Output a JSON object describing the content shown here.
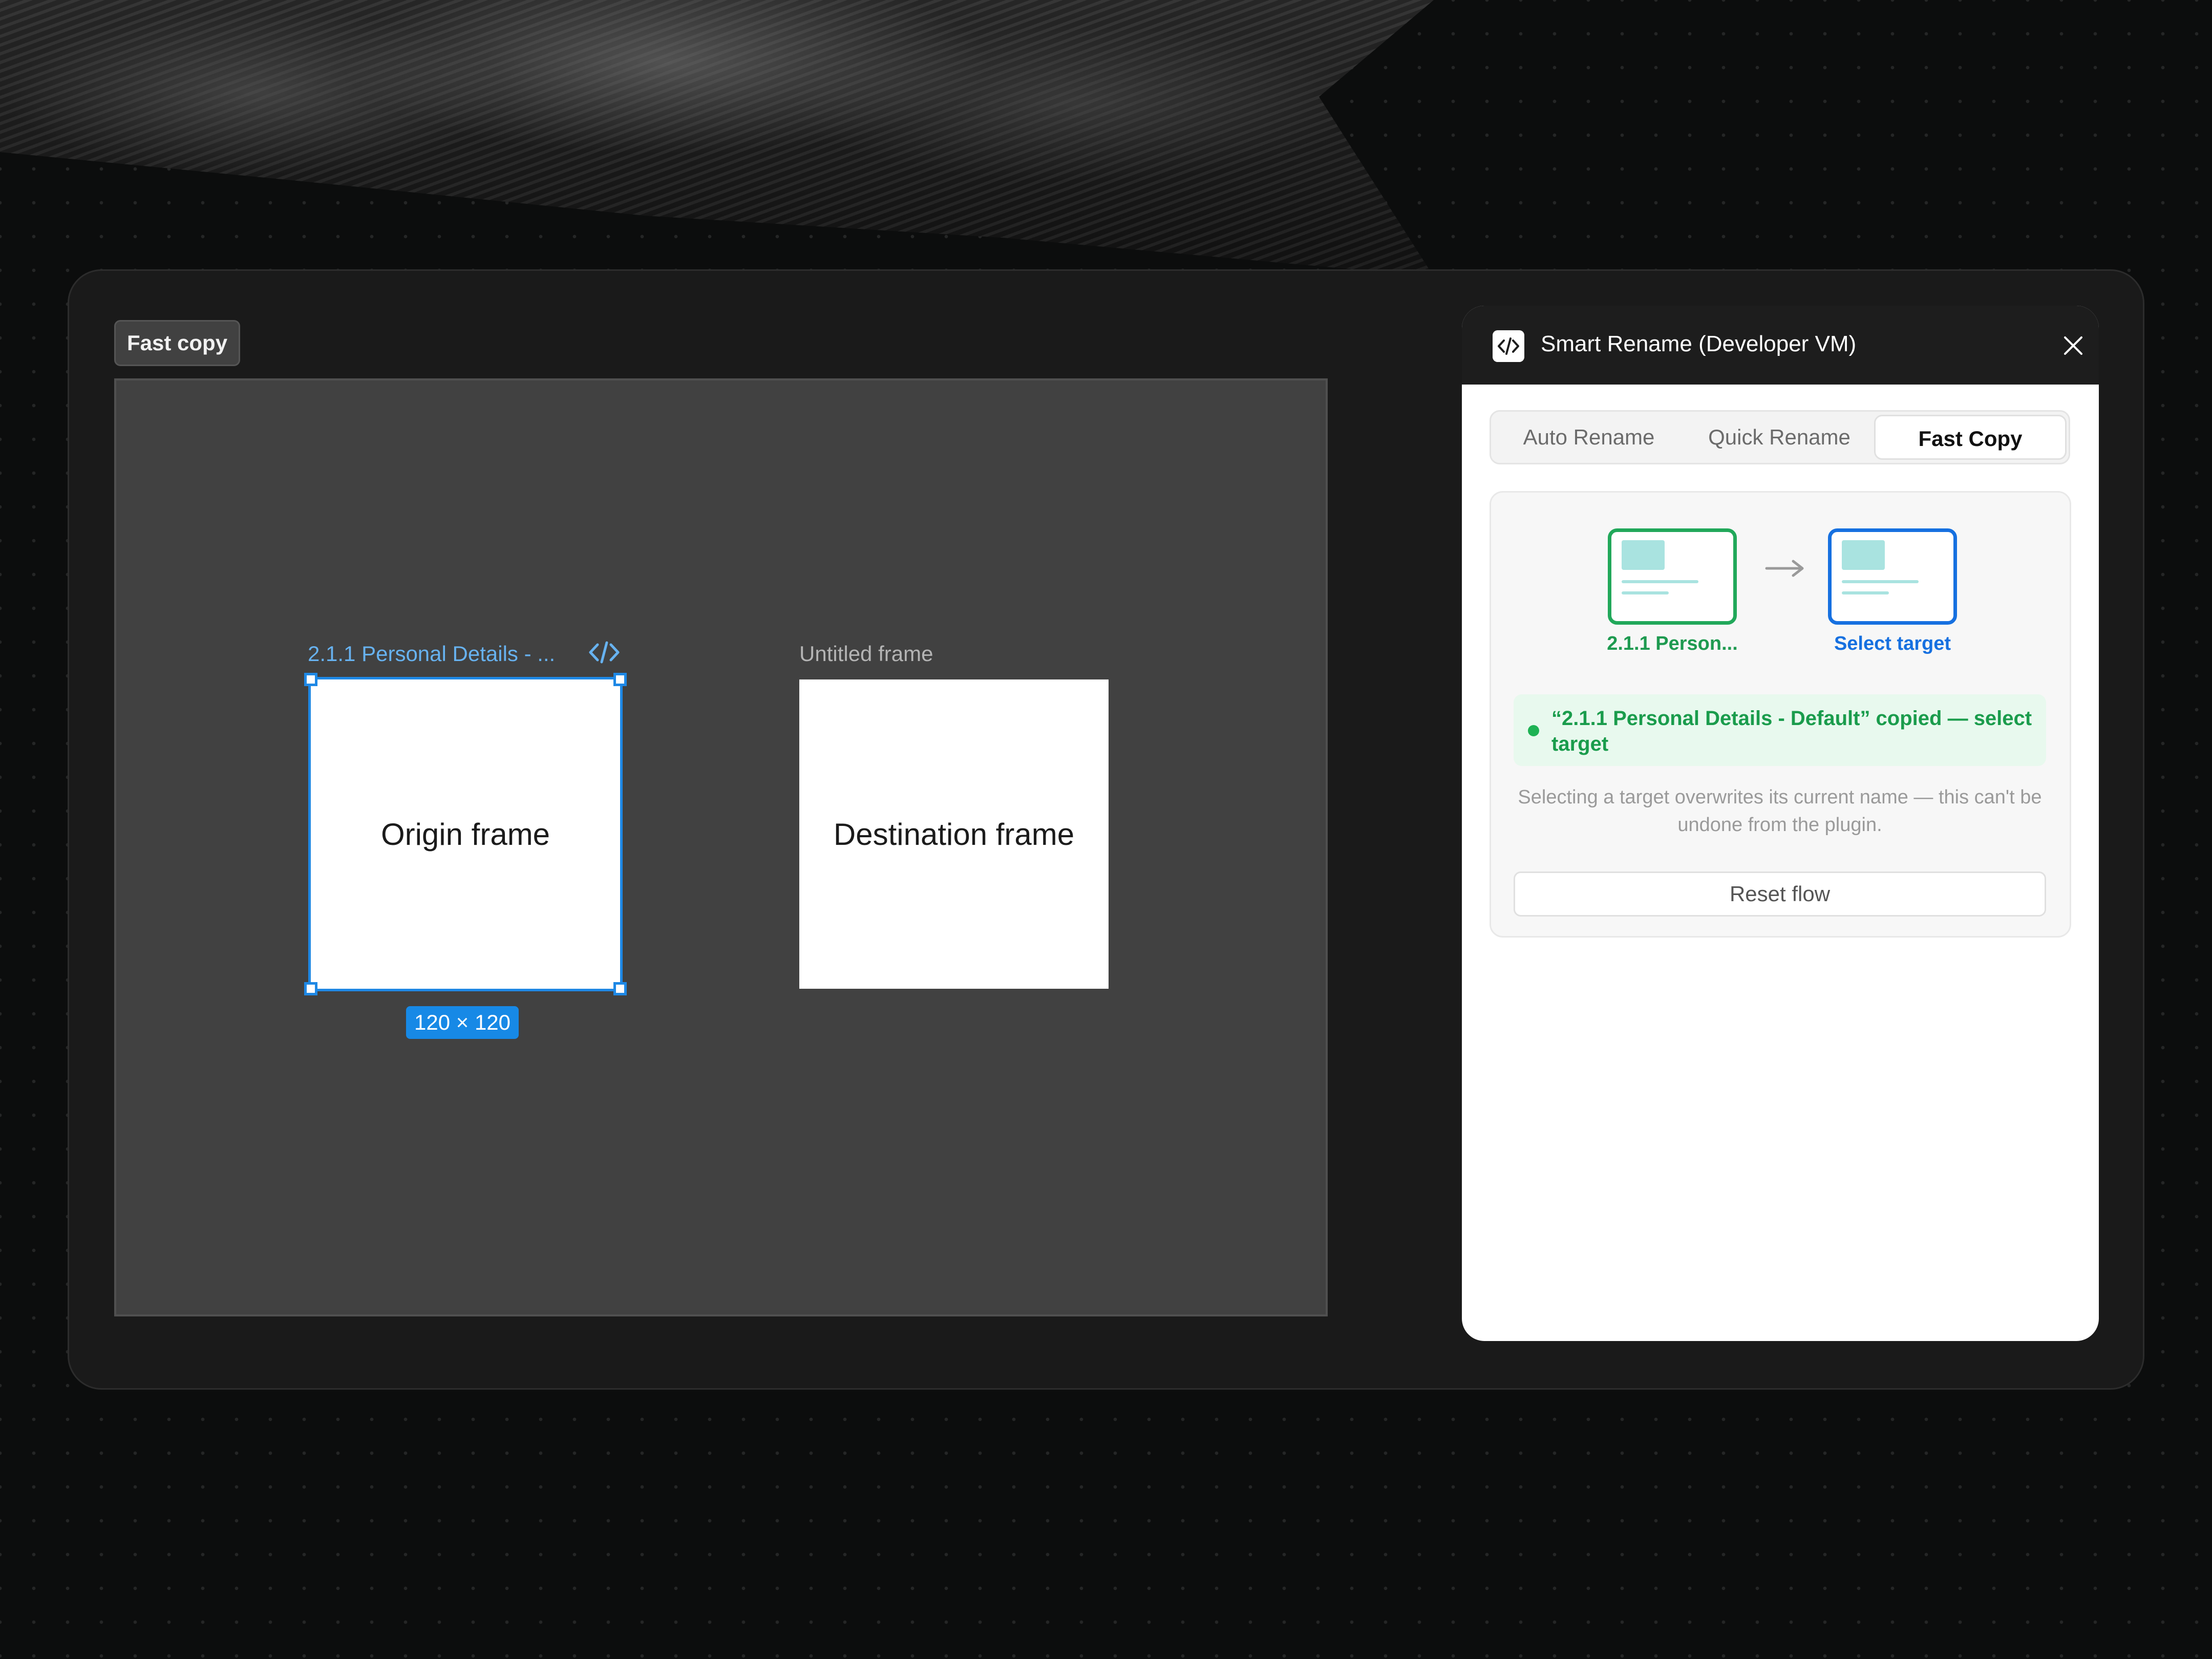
{
  "canvas": {
    "tag_label": "Fast copy",
    "origin": {
      "label": "2.1.1 Personal Details - ...",
      "content": "Origin frame",
      "size": "120 × 120",
      "icon": "code-icon"
    },
    "destination": {
      "label": "Untitled frame",
      "content": "Destination frame"
    }
  },
  "panel": {
    "title": "Smart Rename (Developer VM)",
    "logo_icon": "code-icon",
    "close_icon": "close-icon",
    "tabs": [
      {
        "label": "Auto Rename",
        "active": false
      },
      {
        "label": "Quick Rename",
        "active": false
      },
      {
        "label": "Fast Copy",
        "active": true
      }
    ],
    "flow": {
      "source_label": "2.1.1 Person...",
      "target_label": "Select target",
      "arrow_icon": "arrow-right-icon",
      "status": "“2.1.1 Personal Details - Default” copied — select target",
      "warning": "Selecting a target overwrites its current name — this can't be undone from the plugin.",
      "reset_label": "Reset flow"
    }
  },
  "colors": {
    "accent_blue": "#1e88e5",
    "success_green": "#21a85a",
    "target_blue": "#1670e0"
  }
}
